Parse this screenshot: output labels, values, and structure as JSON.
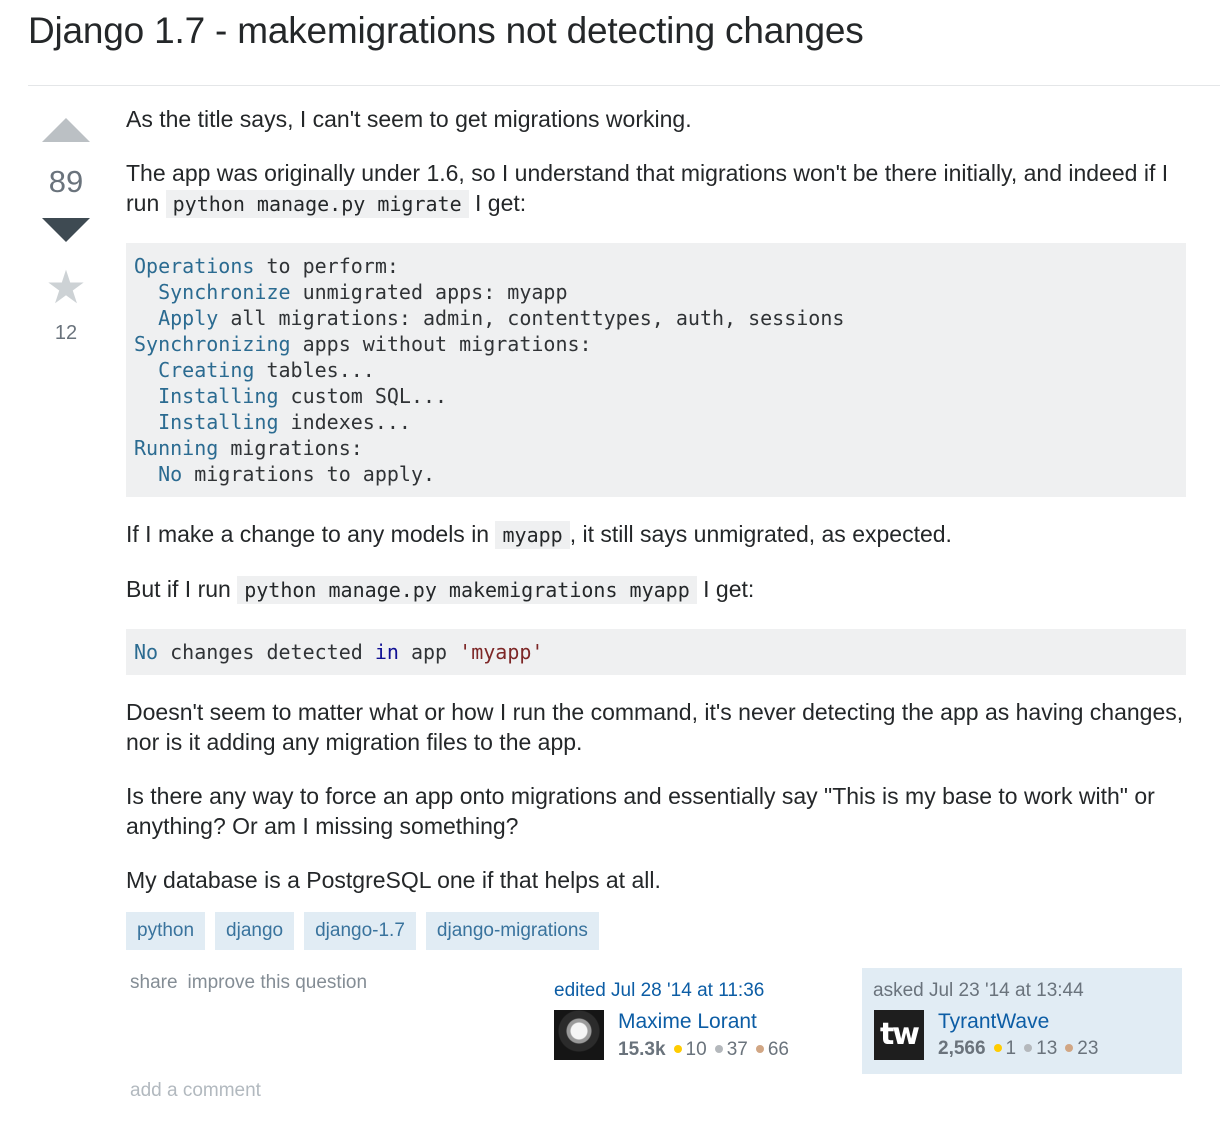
{
  "question": {
    "title": "Django 1.7 - makemigrations not detecting changes",
    "votes": "89",
    "favorites": "12",
    "body": {
      "p1": "As the title says, I can't seem to get migrations working.",
      "p2_before": "The app was originally under 1.6, so I understand that migrations won't be there initially, and indeed if I run ",
      "p2_code": "python manage.py migrate",
      "p2_after": " I get:",
      "pre1_lines": [
        {
          "kw": "Operations",
          "rest": " to perform:"
        },
        {
          "kw": "  Synchronize",
          "rest": " unmigrated apps: myapp"
        },
        {
          "kw": "  Apply",
          "rest": " all migrations: admin, contenttypes, auth, sessions"
        },
        {
          "kw": "Synchronizing",
          "rest": " apps without migrations:"
        },
        {
          "kw": "  Creating",
          "rest": " tables..."
        },
        {
          "kw": "  Installing",
          "rest": " custom SQL..."
        },
        {
          "kw": "  Installing",
          "rest": " indexes..."
        },
        {
          "kw": "Running",
          "rest": " migrations:"
        },
        {
          "kw": "  No",
          "rest": " migrations to apply."
        }
      ],
      "p3_before": "If I make a change to any models in ",
      "p3_code": "myapp",
      "p3_after": ", it still says unmigrated, as expected.",
      "p4_before": "But if I run ",
      "p4_code": "python manage.py makemigrations myapp",
      "p4_after": " I get:",
      "pre2": {
        "kw": "No",
        "mid1": " changes detected ",
        "kw2": "in",
        "mid2": " app ",
        "str": "'myapp'"
      },
      "p5": "Doesn't seem to matter what or how I run the command, it's never detecting the app as having changes, nor is it adding any migration files to the app.",
      "p6": "Is there any way to force an app onto migrations and essentially say \"This is my base to work with\" or anything? Or am I missing something?",
      "p7": "My database is a PostgreSQL one if that helps at all."
    },
    "tags": [
      "python",
      "django",
      "django-1.7",
      "django-migrations"
    ],
    "menu": {
      "share": "share",
      "improve": "improve this question"
    },
    "edited": {
      "action": "edited Jul 28 '14 at 11:36",
      "user": "Maxime Lorant",
      "rep": "15.3k",
      "gold": "10",
      "silver": "37",
      "bronze": "66"
    },
    "asked": {
      "action": "asked Jul 23 '14 at 13:44",
      "user": "TyrantWave",
      "avatar_text": "tw",
      "rep": "2,566",
      "gold": "1",
      "silver": "13",
      "bronze": "23"
    },
    "add_comment": "add a comment"
  },
  "colors": {
    "link": "#0c5da5",
    "tag_bg": "#e1ecf4",
    "tag_text": "#39739d",
    "code_bg": "#eff0f1",
    "code_keyword": "#2b6b91",
    "gold": "#ffcc01",
    "silver": "#b4b8bc",
    "bronze": "#d1a684"
  }
}
